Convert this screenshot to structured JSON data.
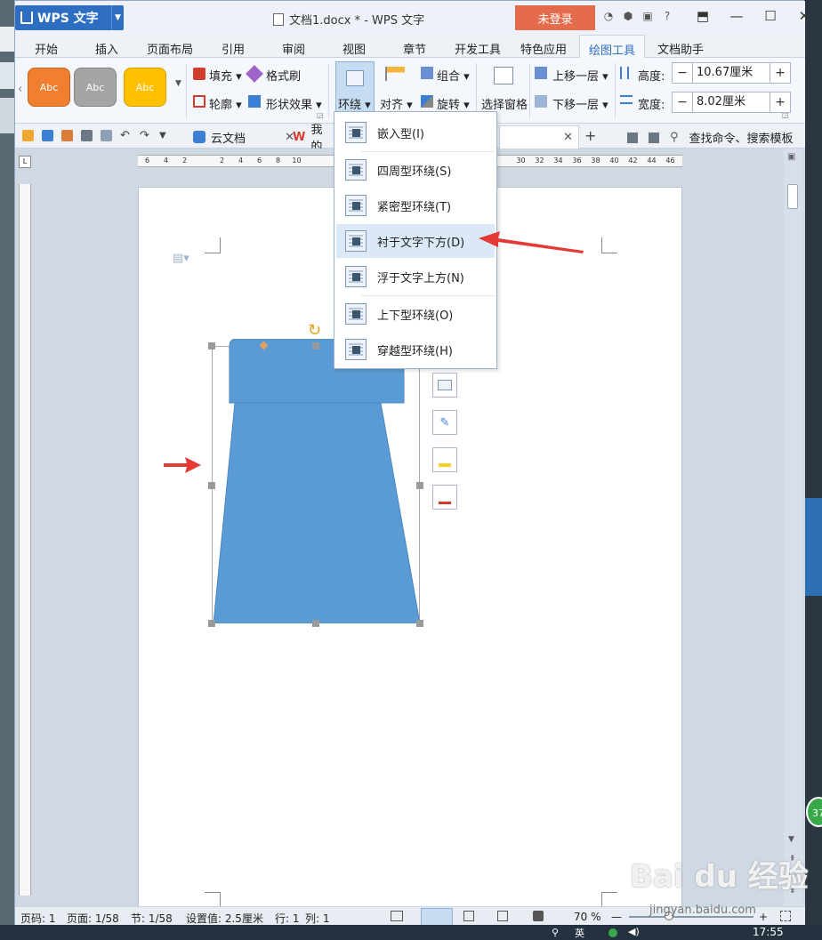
{
  "app": {
    "name": "WPS 文字",
    "doc_title": "文档1.docx * - WPS 文字",
    "login": "未登录"
  },
  "menu_tabs": [
    "开始",
    "插入",
    "页面布局",
    "引用",
    "审阅",
    "视图",
    "章节",
    "开发工具",
    "特色应用",
    "绘图工具",
    "文档助手"
  ],
  "active_tab": "绘图工具",
  "ribbon": {
    "style_label": "Abc",
    "fill": "填充",
    "format_painter": "格式刷",
    "outline": "轮廓",
    "shape_effects": "形状效果",
    "wrap": "环绕",
    "align": "对齐",
    "group": "组合",
    "rotate": "旋转",
    "selection_pane": "选择窗格",
    "bring_forward": "上移一层",
    "send_backward": "下移一层",
    "height_label": "高度:",
    "height_value": "10.67厘米",
    "width_label": "宽度:",
    "width_value": "8.02厘米",
    "minus": "−",
    "plus": "+"
  },
  "quickbar": {
    "tab_cloud": "云文档",
    "tab_my": "我的",
    "search": "查找命令、搜索模板"
  },
  "ruler_numbers": [
    "6",
    "4",
    "2",
    "",
    "2",
    "4",
    "6",
    "8",
    "10",
    "",
    "",
    "",
    "",
    "",
    "",
    "",
    "",
    "",
    "",
    "",
    "30",
    "32",
    "34",
    "36",
    "38",
    "40",
    "42",
    "44",
    "46"
  ],
  "wrap_menu": [
    {
      "label": "嵌入型(I)"
    },
    {
      "label": "四周型环绕(S)"
    },
    {
      "label": "紧密型环绕(T)"
    },
    {
      "label": "衬于文字下方(D)"
    },
    {
      "label": "浮于文字上方(N)"
    },
    {
      "label": "上下型环绕(O)"
    },
    {
      "label": "穿越型环绕(H)"
    }
  ],
  "statusbar": {
    "page_code": "页码: 1",
    "page": "页面: 1/58",
    "section": "节: 1/58",
    "setting": "设置值: 2.5厘米",
    "row": "行: 1",
    "col": "列: 1",
    "zoom": "70 %",
    "time": "17:55"
  },
  "watermark": {
    "brand": "Bai du 经验",
    "url": "jingyan.baidu.com"
  },
  "badge": "37",
  "colors": {
    "accent": "#2d6ec2",
    "shape_fill": "#5b9bd5",
    "arrow": "#e53935",
    "login_bg": "#e46c4c"
  }
}
